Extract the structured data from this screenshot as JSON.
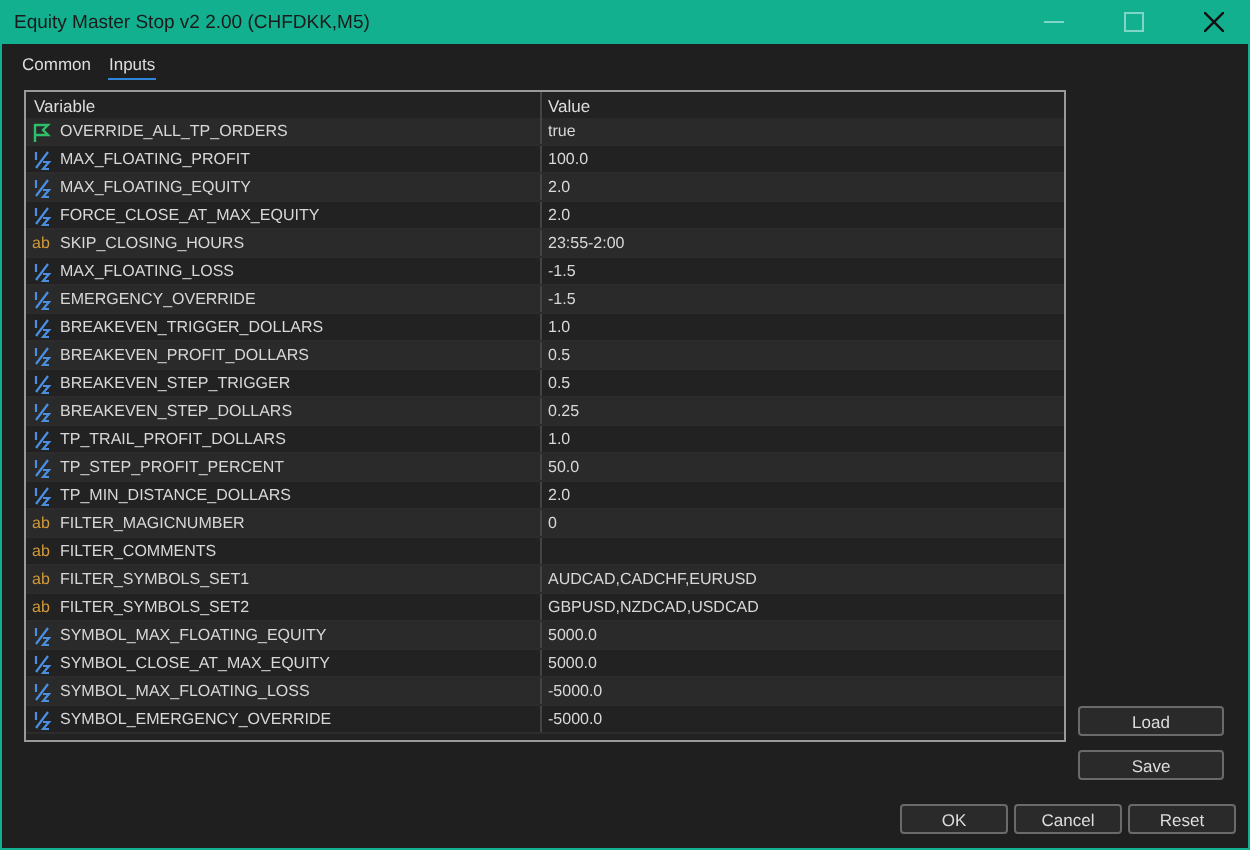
{
  "window": {
    "title": "Equity Master Stop v2 2.00 (CHFDKK,M5)"
  },
  "tabs": [
    {
      "label": "Common",
      "selected": false
    },
    {
      "label": "Inputs",
      "selected": true
    }
  ],
  "table": {
    "columns": [
      "Variable",
      "Value"
    ],
    "rows": [
      {
        "kind": "bool",
        "name": "OVERRIDE_ALL_TP_ORDERS",
        "value": "true"
      },
      {
        "kind": "double",
        "name": "MAX_FLOATING_PROFIT",
        "value": "100.0"
      },
      {
        "kind": "double",
        "name": "MAX_FLOATING_EQUITY",
        "value": "2.0"
      },
      {
        "kind": "double",
        "name": "FORCE_CLOSE_AT_MAX_EQUITY",
        "value": "2.0"
      },
      {
        "kind": "string",
        "icon": "ab",
        "name": "SKIP_CLOSING_HOURS",
        "value": "23:55-2:00"
      },
      {
        "kind": "double",
        "name": "MAX_FLOATING_LOSS",
        "value": "-1.5"
      },
      {
        "kind": "double",
        "name": "EMERGENCY_OVERRIDE",
        "value": "-1.5"
      },
      {
        "kind": "double",
        "name": "BREAKEVEN_TRIGGER_DOLLARS",
        "value": "1.0"
      },
      {
        "kind": "double",
        "name": "BREAKEVEN_PROFIT_DOLLARS",
        "value": "0.5"
      },
      {
        "kind": "double",
        "name": "BREAKEVEN_STEP_TRIGGER",
        "value": "0.5"
      },
      {
        "kind": "double",
        "name": "BREAKEVEN_STEP_DOLLARS",
        "value": "0.25"
      },
      {
        "kind": "double",
        "name": "TP_TRAIL_PROFIT_DOLLARS",
        "value": "1.0"
      },
      {
        "kind": "double",
        "name": "TP_STEP_PROFIT_PERCENT",
        "value": "50.0"
      },
      {
        "kind": "double",
        "name": "TP_MIN_DISTANCE_DOLLARS",
        "value": "2.0"
      },
      {
        "kind": "string",
        "icon": "ab",
        "name": "FILTER_MAGICNUMBER",
        "value": "0"
      },
      {
        "kind": "string",
        "icon": "ab",
        "name": "FILTER_COMMENTS"
      },
      {
        "kind": "string",
        "icon": "ab",
        "name": "FILTER_SYMBOLS_SET1",
        "value": "AUDCAD,CADCHF,EURUSD"
      },
      {
        "kind": "string",
        "icon": "ab",
        "name": "FILTER_SYMBOLS_SET2",
        "value": "GBPUSD,NZDCAD,USDCAD"
      },
      {
        "kind": "double",
        "name": "SYMBOL_MAX_FLOATING_EQUITY",
        "value": "5000.0"
      },
      {
        "kind": "double",
        "name": "SYMBOL_CLOSE_AT_MAX_EQUITY",
        "value": "5000.0"
      },
      {
        "kind": "double",
        "name": "SYMBOL_MAX_FLOATING_LOSS",
        "value": "-5000.0"
      },
      {
        "kind": "double",
        "name": "SYMBOL_EMERGENCY_OVERRIDE",
        "value": "-5000.0"
      }
    ]
  },
  "side_buttons": [
    "Load",
    "Save"
  ],
  "buttons": [
    "OK",
    "Cancel",
    "Reset"
  ]
}
